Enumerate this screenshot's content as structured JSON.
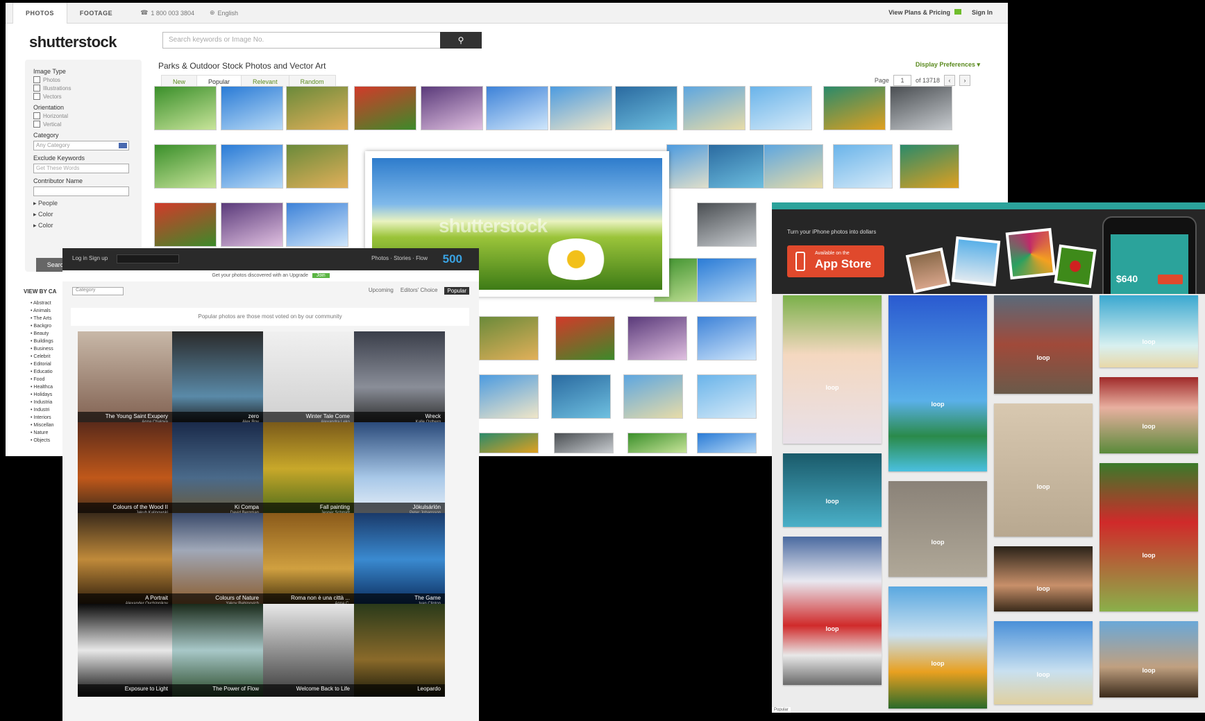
{
  "shutterstock": {
    "tabs": [
      "PHOTOS",
      "FOOTAGE"
    ],
    "phone": "1 800 003 3804",
    "language": "English",
    "top_right": "View Plans & Pricing",
    "sign_in": "Sign In",
    "logo": "shutterstock",
    "search_placeholder": "Search keywords or Image No.",
    "page_title": "Parks & Outdoor Stock Photos and Vector Art",
    "display_prefs": "Display Preferences",
    "sort_tabs": [
      "New",
      "Popular",
      "Relevant",
      "Random"
    ],
    "pager": {
      "label": "Page",
      "value": "1",
      "of": "of 13718"
    },
    "sidebar": {
      "image_type_label": "Image Type",
      "image_types": [
        "Photos",
        "Illustrations",
        "Vectors"
      ],
      "orientation_label": "Orientation",
      "orientations": [
        "Horizontal",
        "Vertical"
      ],
      "category_label": "Category",
      "category_value": "Any Category",
      "exclude_label": "Exclude Keywords",
      "exclude_placeholder": "Get These Words",
      "contributor_label": "Contributor Name",
      "expanders": [
        "People",
        "Color",
        "Color"
      ],
      "search_button": "Search"
    },
    "view_by": "VIEW BY CA",
    "categories": [
      "Abstract",
      "Animals",
      "The Arts",
      "Backgro",
      "Beauty",
      "Buildings",
      "Business",
      "Celebrit",
      "Editorial",
      "Educatio",
      "Food",
      "Healthca",
      "Holidays",
      "Industria",
      "Industri",
      "Interiors",
      "Miscellan",
      "Nature",
      "Objects"
    ],
    "preview_watermark": "shutterstock"
  },
  "fivehundred": {
    "logo": "500",
    "nav": "Photos  ·  Stories  ·  Flow",
    "login": "Log in   Sign up",
    "promo": "Get your photos discovered with an Upgrade",
    "promo_button": "Join",
    "tabs": [
      "Popular",
      "Editors' Choice",
      "Upcoming"
    ],
    "dropdown": "Category",
    "notice": "Popular photos are those most voted on by our community",
    "photos": [
      {
        "title": "Wreck",
        "author": "Kalle Ostberg"
      },
      {
        "title": "Winter Tale Come",
        "author": "Alexandra Leko"
      },
      {
        "title": "zero",
        "author": "Alex Roy"
      },
      {
        "title": "The Young Saint Exupery",
        "author": "Anna Chalova"
      },
      {
        "title": "Jökulsárlón",
        "author": "Peter Johansson"
      },
      {
        "title": "Fall painting",
        "author": "Jesper Schmidt"
      },
      {
        "title": "Ki Compa",
        "author": "David Bergman"
      },
      {
        "title": "Colours of the Wood II",
        "author": "Jakub Kalinowski"
      },
      {
        "title": "The Game",
        "author": "Ivan Clinton"
      },
      {
        "title": "Roma non è una città ...",
        "author": "Anna C."
      },
      {
        "title": "Colours of Nature",
        "author": "Yakov Rebinovich"
      },
      {
        "title": "A Portrait",
        "author": "Alexander Ovchinnikov"
      },
      {
        "title": "Leopardo",
        "author": ""
      },
      {
        "title": "Welcome Back to Life",
        "author": ""
      },
      {
        "title": "The Power of Flow",
        "author": ""
      },
      {
        "title": "Exposure to Light",
        "author": ""
      }
    ]
  },
  "loop": {
    "tagline": "Turn your iPhone photos into dollars",
    "app_small": "Available on the",
    "app_big": "App Store",
    "phone_value": "$640",
    "watermark": "loop",
    "footer": "Popular"
  }
}
